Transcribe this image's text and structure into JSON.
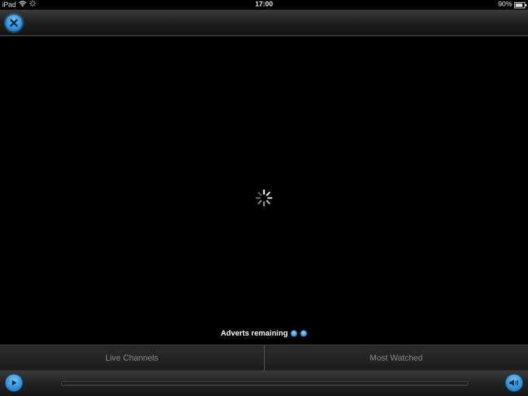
{
  "status_bar": {
    "device": "iPad",
    "time": "17:00",
    "battery": "90%"
  },
  "top_bar": {
    "close_icon": "close-icon"
  },
  "player": {
    "loading_icon": "spinner-icon",
    "adverts_label": "Adverts remaining",
    "adverts_remaining": 2,
    "progress": 0
  },
  "tabs": [
    {
      "label": "Live Channels"
    },
    {
      "label": "Most Watched"
    }
  ],
  "controls": {
    "play_icon": "play-icon",
    "volume_icon": "volume-icon"
  },
  "colors": {
    "accent": "#2d8fd8",
    "background": "#000000",
    "tab_text": "#8a8a8a"
  }
}
